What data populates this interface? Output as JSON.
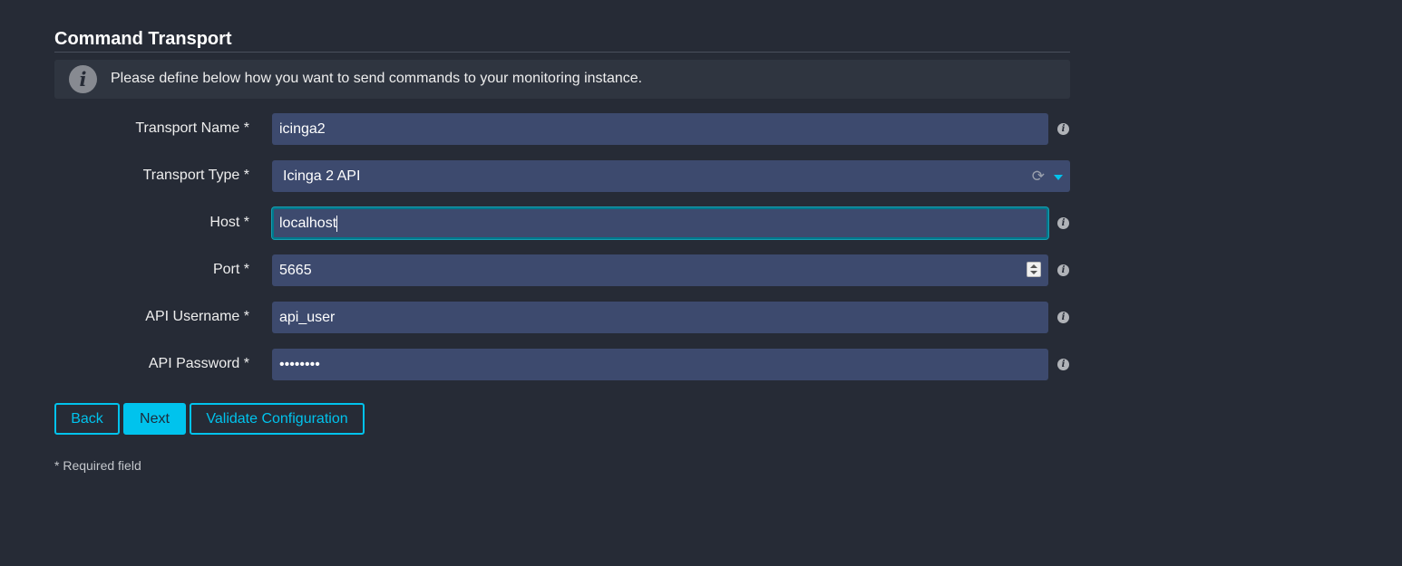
{
  "form": {
    "title": "Command Transport",
    "info_text": "Please define below how you want to send commands to your monitoring instance.",
    "fields": [
      {
        "label": "Transport Name *",
        "value": "icinga2"
      },
      {
        "label": "Transport Type *",
        "value": "Icinga 2 API"
      },
      {
        "label": "Host *",
        "value": "localhost"
      },
      {
        "label": "Port *",
        "value": "5665"
      },
      {
        "label": "API Username *",
        "value": "api_user"
      },
      {
        "label": "API Password *",
        "value": "••••••••"
      }
    ],
    "buttons": {
      "back": "Back",
      "next": "Next",
      "validate": "Validate Configuration"
    },
    "required_note": "* Required field"
  },
  "icons": {
    "info": "info-icon",
    "help": "help-icon",
    "reload": "reload-icon",
    "dropdown": "chevron-down-icon",
    "spinner": "number-stepper"
  },
  "colors": {
    "background": "#262b36",
    "input_bg": "#3d4a6e",
    "accent": "#00c3ed",
    "focus_border": "#00788c"
  }
}
